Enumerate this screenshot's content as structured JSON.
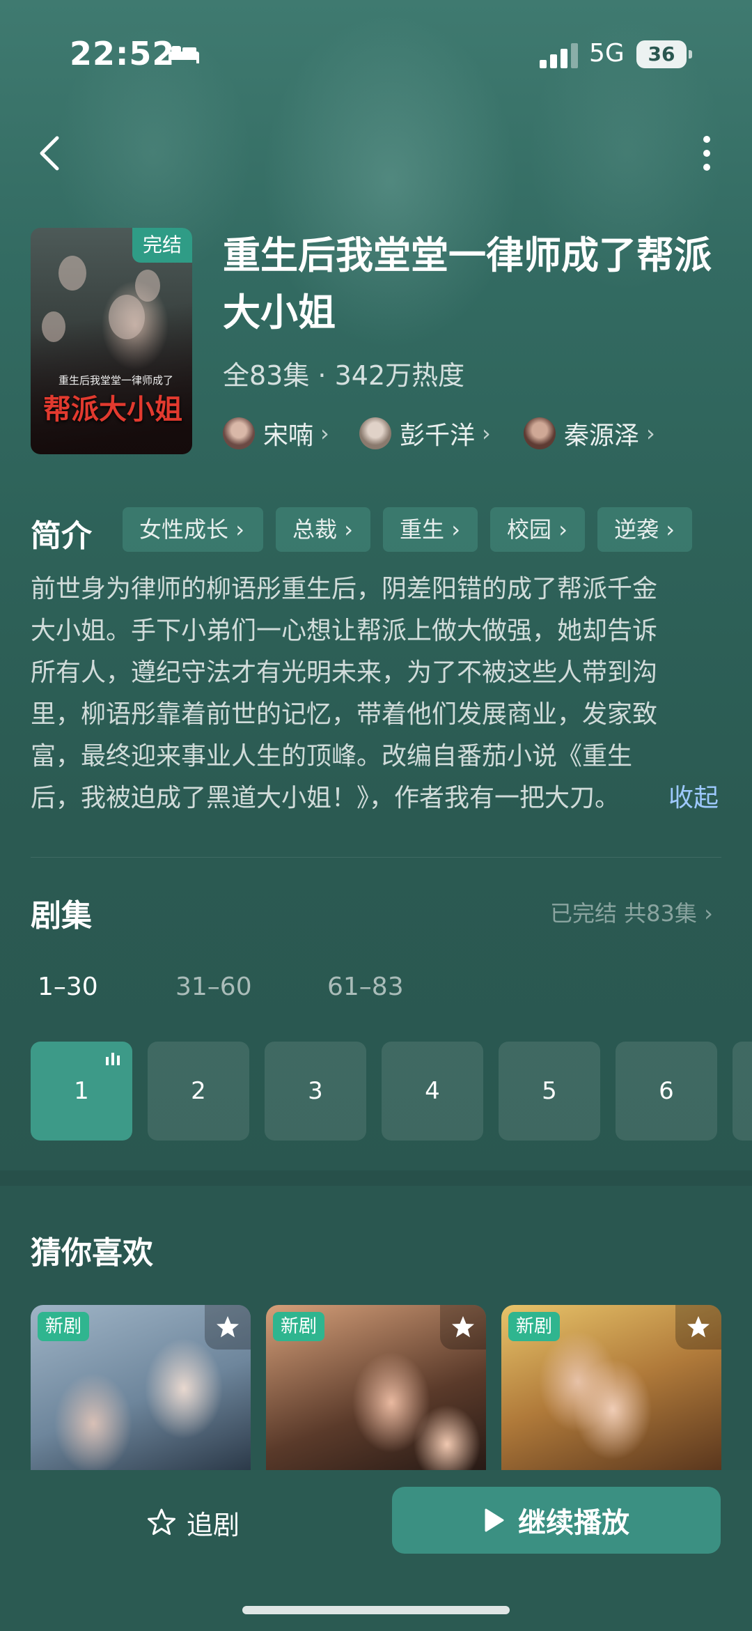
{
  "status_bar": {
    "time": "22:52",
    "network": "5G",
    "battery": "36"
  },
  "drama": {
    "cover_badge": "完结",
    "cover_title": "帮派大小姐",
    "cover_subtitle": "重生后我堂堂一律师成了",
    "title": "重生后我堂堂一律师成了帮派大小姐",
    "meta": "全83集 · 342万热度",
    "cast": [
      {
        "name": "宋喃",
        "avatar_color": "#6b4a44"
      },
      {
        "name": "彭千洋",
        "avatar_color": "#8a7a6e"
      },
      {
        "name": "秦源泽",
        "avatar_color": "#5e3b33"
      }
    ]
  },
  "intro": {
    "heading": "简介",
    "tags": [
      "女性成长",
      "总裁",
      "重生",
      "校园",
      "逆袭"
    ],
    "lines": [
      "前世身为律师的柳语彤重生后，阴差阳错的成了帮派千金",
      "大小姐。手下小弟们一心想让帮派上做大做强，她却告诉",
      "所有人，遵纪守法才有光明未来，为了不被这些人带到沟",
      "里，柳语彤靠着前世的记忆，带着他们发展商业，发家致",
      "富，最终迎来事业人生的顶峰。改编自番茄小说《重生",
      "后，我被迫成了黑道大小姐！》，作者我有一把大刀。"
    ],
    "collapse": "收起"
  },
  "episodes": {
    "heading": "剧集",
    "status": "已完结 共83集",
    "ranges": [
      "1–30",
      "31–60",
      "61–83"
    ],
    "active_range": 0,
    "items": [
      "1",
      "2",
      "3",
      "4",
      "5",
      "6"
    ],
    "playing": "1"
  },
  "recommend": {
    "heading": "猜你喜欢",
    "items": [
      {
        "badge": "新剧"
      },
      {
        "badge": "新剧"
      },
      {
        "badge": "新剧"
      }
    ]
  },
  "bottom_bar": {
    "follow": "追剧",
    "play": "继续播放"
  },
  "colors": {
    "accent": "#3b9082",
    "active_episode": "#3d9a88",
    "new_badge": "#2fb58f",
    "link": "#9ec9ff"
  }
}
